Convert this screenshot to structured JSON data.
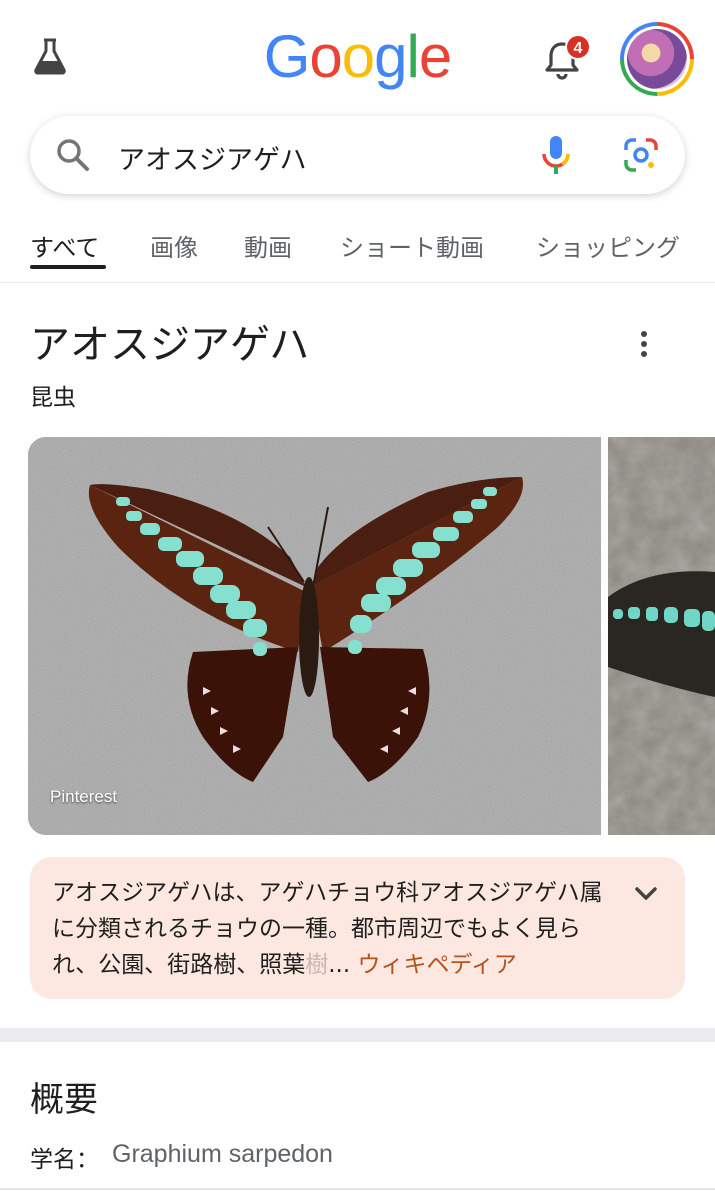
{
  "header": {
    "logo_letters": [
      {
        "char": "G",
        "color": "#4285f4"
      },
      {
        "char": "o",
        "color": "#ea4335"
      },
      {
        "char": "o",
        "color": "#fbbc05"
      },
      {
        "char": "g",
        "color": "#4285f4"
      },
      {
        "char": "l",
        "color": "#34a853"
      },
      {
        "char": "e",
        "color": "#ea4335"
      }
    ],
    "labs_icon": "flask-icon",
    "notification_icon": "bell-icon",
    "notification_count": "4",
    "avatar": "profile-avatar"
  },
  "search": {
    "query": "アオスジアゲハ",
    "search_icon": "search-icon",
    "mic_icon": "microphone-icon",
    "lens_icon": "google-lens-icon"
  },
  "tabs": [
    {
      "label": "すべて",
      "active": true
    },
    {
      "label": "画像",
      "active": false
    },
    {
      "label": "動画",
      "active": false
    },
    {
      "label": "ショート動画",
      "active": false
    },
    {
      "label": "ショッピング",
      "active": false
    }
  ],
  "knowledge_panel": {
    "title": "アオスジアゲハ",
    "subtitle": "昆虫",
    "more_icon": "more-vert-icon",
    "images": [
      {
        "source": "Pinterest",
        "depicts": "butterfly-specimen"
      },
      {
        "source": "",
        "depicts": "butterfly-on-rock"
      }
    ],
    "description": {
      "text": "アオスジアゲハは、アゲハチョウ科アオスジアゲハ属に分類されるチョウの一種。都市周辺でもよく見られ、公園、街路樹、照葉",
      "faded_char": "樹",
      "ellipsis": "...",
      "link_label": "ウィキペディア",
      "expand_icon": "chevron-down-icon"
    }
  },
  "overview": {
    "title": "概要",
    "scientific_name_label": "学名：",
    "scientific_name_value": "Graphium sarpedon"
  }
}
